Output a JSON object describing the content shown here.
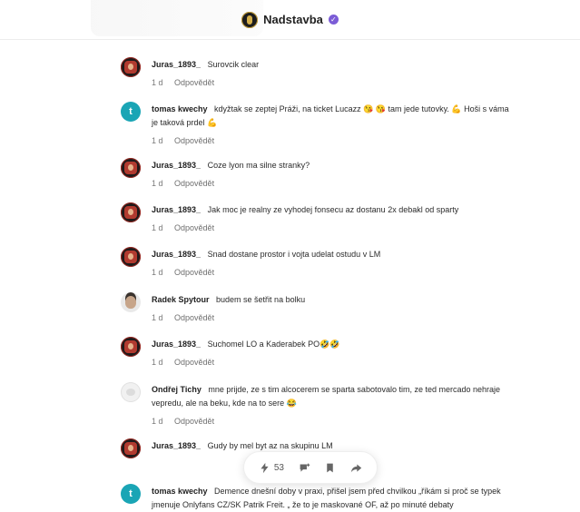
{
  "header": {
    "title": "Nadstavba"
  },
  "meta": {
    "age": "1 d",
    "reply_label": "Odpovědět"
  },
  "actions": {
    "likes": "53"
  },
  "comments": [
    {
      "author": "Juras_1893_",
      "avatar": "juras",
      "text": "Surovcik clear"
    },
    {
      "author": "tomas kwechy",
      "avatar": "tomas",
      "avatar_letter": "t",
      "text": "kdyžtak se zeptej Práži, na ticket Lucazz 😘 😘 tam jede tutovky. 💪 Hoši s vámа je taková prdel 💪"
    },
    {
      "author": "Juras_1893_",
      "avatar": "juras",
      "text": "Coze lyon ma silne stranky?"
    },
    {
      "author": "Juras_1893_",
      "avatar": "juras",
      "text": "Jak moc je realny ze vyhodej fonsecu az dostanu 2x debakl od sparty"
    },
    {
      "author": "Juras_1893_",
      "avatar": "juras",
      "text": "Snad dostane prostor i vojta udelat ostudu v LM"
    },
    {
      "author": "Radek Spytour",
      "avatar": "radek",
      "text": "budem se šetřit na bolku"
    },
    {
      "author": "Juras_1893_",
      "avatar": "juras",
      "text": "Suchomel LO a Kaderabek PO🤣🤣"
    },
    {
      "author": "Ondřej Tichy",
      "avatar": "ondrej",
      "text": "mne prijde, ze s tim alcocerem se sparta sabotovalo tim, ze ted mercado nehraje vepredu, ale na beku, kde na to sere 😂"
    },
    {
      "author": "Juras_1893_",
      "avatar": "juras",
      "text": "Gudy by mel byt az na skupinu LM"
    },
    {
      "author": "tomas kwechy",
      "avatar": "tomas",
      "avatar_letter": "t",
      "text": "Demence dnešní doby v praxi, přišel jsem před chvilkou „říkám si proč se typek jmenuje Onlyfans CZ/SK Patrik Freit. „ že to je maskované OF, až po minuté debaty"
    }
  ]
}
